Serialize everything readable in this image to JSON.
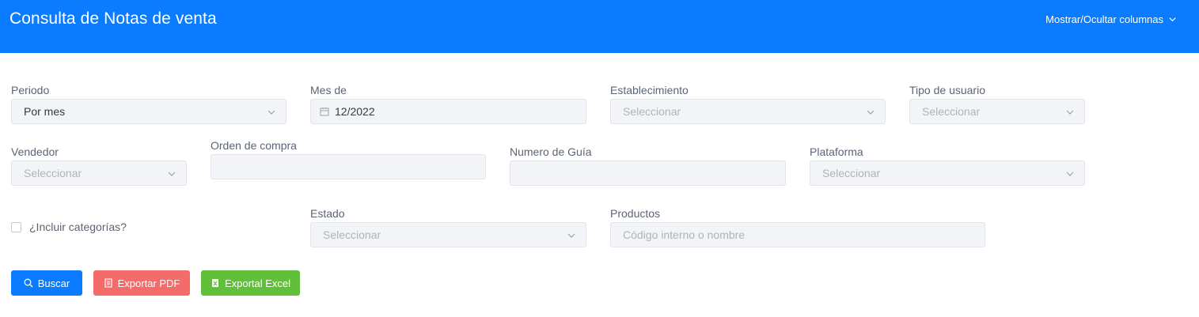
{
  "header": {
    "title": "Consulta de Notas de venta",
    "columns_toggle": "Mostrar/Ocultar columnas"
  },
  "filters": {
    "periodo": {
      "label": "Periodo",
      "value": "Por mes"
    },
    "mes": {
      "label": "Mes de",
      "value": "12/2022"
    },
    "establecimiento": {
      "label": "Establecimiento",
      "placeholder": "Seleccionar"
    },
    "tipo_usuario": {
      "label": "Tipo de usuario",
      "placeholder": "Seleccionar"
    },
    "vendedor": {
      "label": "Vendedor",
      "placeholder": "Seleccionar"
    },
    "orden_compra": {
      "label": "Orden de compra",
      "value": ""
    },
    "numero_guia": {
      "label": "Numero de Guía",
      "value": ""
    },
    "plataforma": {
      "label": "Plataforma",
      "placeholder": "Seleccionar"
    },
    "incluir_categorias": {
      "label": "¿Incluir categorías?",
      "checked": false
    },
    "estado": {
      "label": "Estado",
      "placeholder": "Seleccionar"
    },
    "productos": {
      "label": "Productos",
      "placeholder": "Código interno o nombre"
    }
  },
  "buttons": {
    "search": "Buscar",
    "export_pdf": "Exportar PDF",
    "export_excel": "Exportal Excel"
  },
  "colors": {
    "primary": "#0b7cff",
    "danger": "#f36b6b",
    "success": "#62bf3a"
  },
  "icons": {
    "search": "search-icon",
    "pdf": "document-icon",
    "excel": "excel-file-icon",
    "calendar": "calendar-icon",
    "chevron": "chevron-down-icon"
  }
}
